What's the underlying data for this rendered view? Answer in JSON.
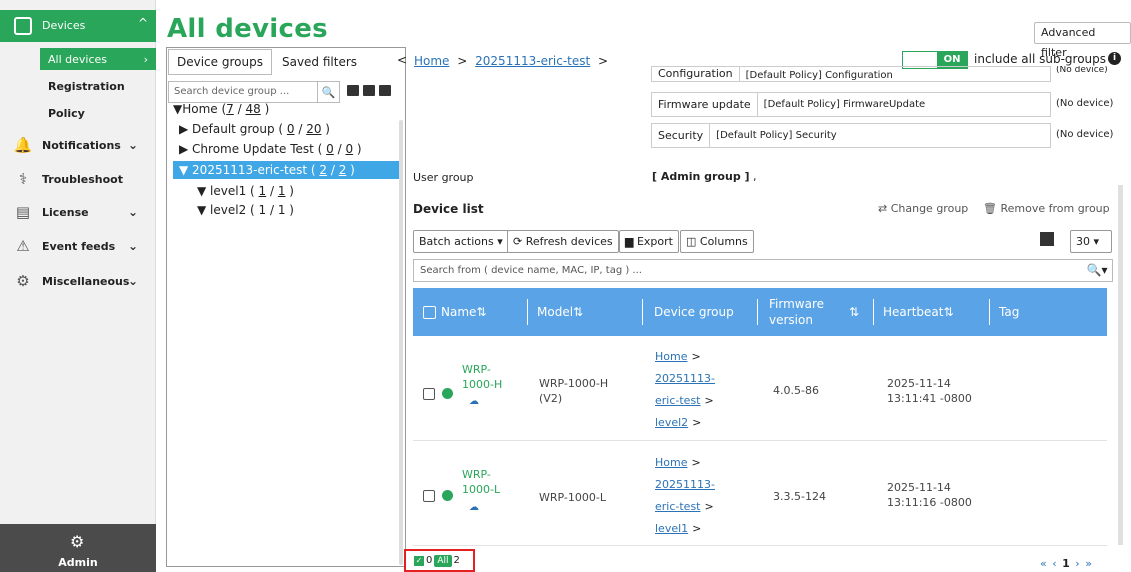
{
  "sidebar": {
    "devices": {
      "label": "Devices",
      "icon": "device-icon"
    },
    "devices_sub": [
      {
        "label": "All devices",
        "active": true
      },
      {
        "label": "Registration"
      },
      {
        "label": "Policy"
      }
    ],
    "items": [
      {
        "label": "Notifications",
        "icon": "bell-icon",
        "expandable": true
      },
      {
        "label": "Troubleshoot",
        "icon": "stethoscope-icon",
        "expandable": false
      },
      {
        "label": "License",
        "icon": "license-icon",
        "expandable": true
      },
      {
        "label": "Event feeds",
        "icon": "event-feeds-icon",
        "expandable": true
      },
      {
        "label": "Miscellaneous",
        "icon": "gears-icon",
        "expandable": true
      }
    ],
    "admin": {
      "label": "Admin",
      "icon": "admin-gear-icon"
    }
  },
  "page": {
    "title": "All devices"
  },
  "tree": {
    "tabs": [
      "Device groups",
      "Saved filters"
    ],
    "search_placeholder": "Search device group ...",
    "nodes": [
      {
        "text": "▼Home (",
        "a": "7",
        "mid": " / ",
        "b": "48",
        "end": " )"
      },
      {
        "text": "▶ Default group ( ",
        "a": "0",
        "mid": " / ",
        "b": "20",
        "end": " )"
      },
      {
        "text": "▶ Chrome Update Test ( ",
        "a": "0",
        "mid": " / ",
        "b": "0",
        "end": " )"
      },
      {
        "text": "▼ 20251113-eric-test ( ",
        "a": "2",
        "mid": " / ",
        "b": "2",
        "end": " )"
      },
      {
        "text": "▼ level1 ( ",
        "a": "1",
        "mid": " / ",
        "b": "1",
        "end": " )"
      },
      {
        "text": "▼ level2 ( ",
        "a": "1",
        "mid": " / ",
        "b": "1",
        "end": " )"
      }
    ]
  },
  "breadcrumb": {
    "home": "Home",
    "group": "20251113-eric-test",
    "sep": ">",
    "back": "<"
  },
  "controls": {
    "advanced_filter": "Advanced filter",
    "toggle": "ON",
    "subgroups_label": "include all sub-groups",
    "info": "i"
  },
  "policies": [
    {
      "key": "Configuration",
      "value": "[Default Policy] Configuration",
      "note": "(No device)"
    },
    {
      "key": "Firmware update",
      "value": "[Default Policy] FirmwareUpdate",
      "note": "(No device)"
    },
    {
      "key": "Security",
      "value": "[Default Policy] Security",
      "note": "(No device)"
    }
  ],
  "user_group": {
    "label": "User group",
    "value": "[ Admin group ]",
    "trail": " ,"
  },
  "device_list": {
    "label": "Device list",
    "change_group": "⇄ Change group",
    "remove_group": "🗑 Remove from group",
    "batch_actions": "Batch actions ▾",
    "refresh": "⟳ Refresh devices",
    "export": "Export",
    "columns": "Columns",
    "page_size": "30 ▾",
    "search_placeholder": "Search from ( device name, MAC, IP, tag ) ...",
    "search_btn": "🔍▾"
  },
  "table": {
    "headers": [
      "Name",
      "Model",
      "Device group",
      "Firmware version",
      "Heartbeat",
      "Tag"
    ],
    "rows": [
      {
        "name": [
          "WRP-",
          "1000-H"
        ],
        "model": [
          "WRP-1000-H",
          "(V2)"
        ],
        "group": [
          "Home",
          "20251113-",
          "eric-test",
          "level2"
        ],
        "firmware": "4.0.5-86",
        "heartbeat": [
          "2025-11-14",
          "13:11:41 -0800"
        ]
      },
      {
        "name": [
          "WRP-",
          "1000-L"
        ],
        "model": [
          "WRP-1000-L"
        ],
        "group": [
          "Home",
          "20251113-",
          "eric-test",
          "level1"
        ],
        "firmware": "3.3.5-124",
        "heartbeat": [
          "2025-11-14",
          "13:11:16 -0800"
        ]
      }
    ]
  },
  "footer": {
    "checked": "0",
    "all_label": "All",
    "total": "2",
    "pager": {
      "first": "«",
      "prev": "‹",
      "page": "1",
      "next": "›",
      "last": "»"
    }
  },
  "colors": {
    "brand": "#29a65a",
    "header": "#5aa3e6",
    "selected": "#3fa7e6",
    "link": "#2b73b6"
  }
}
